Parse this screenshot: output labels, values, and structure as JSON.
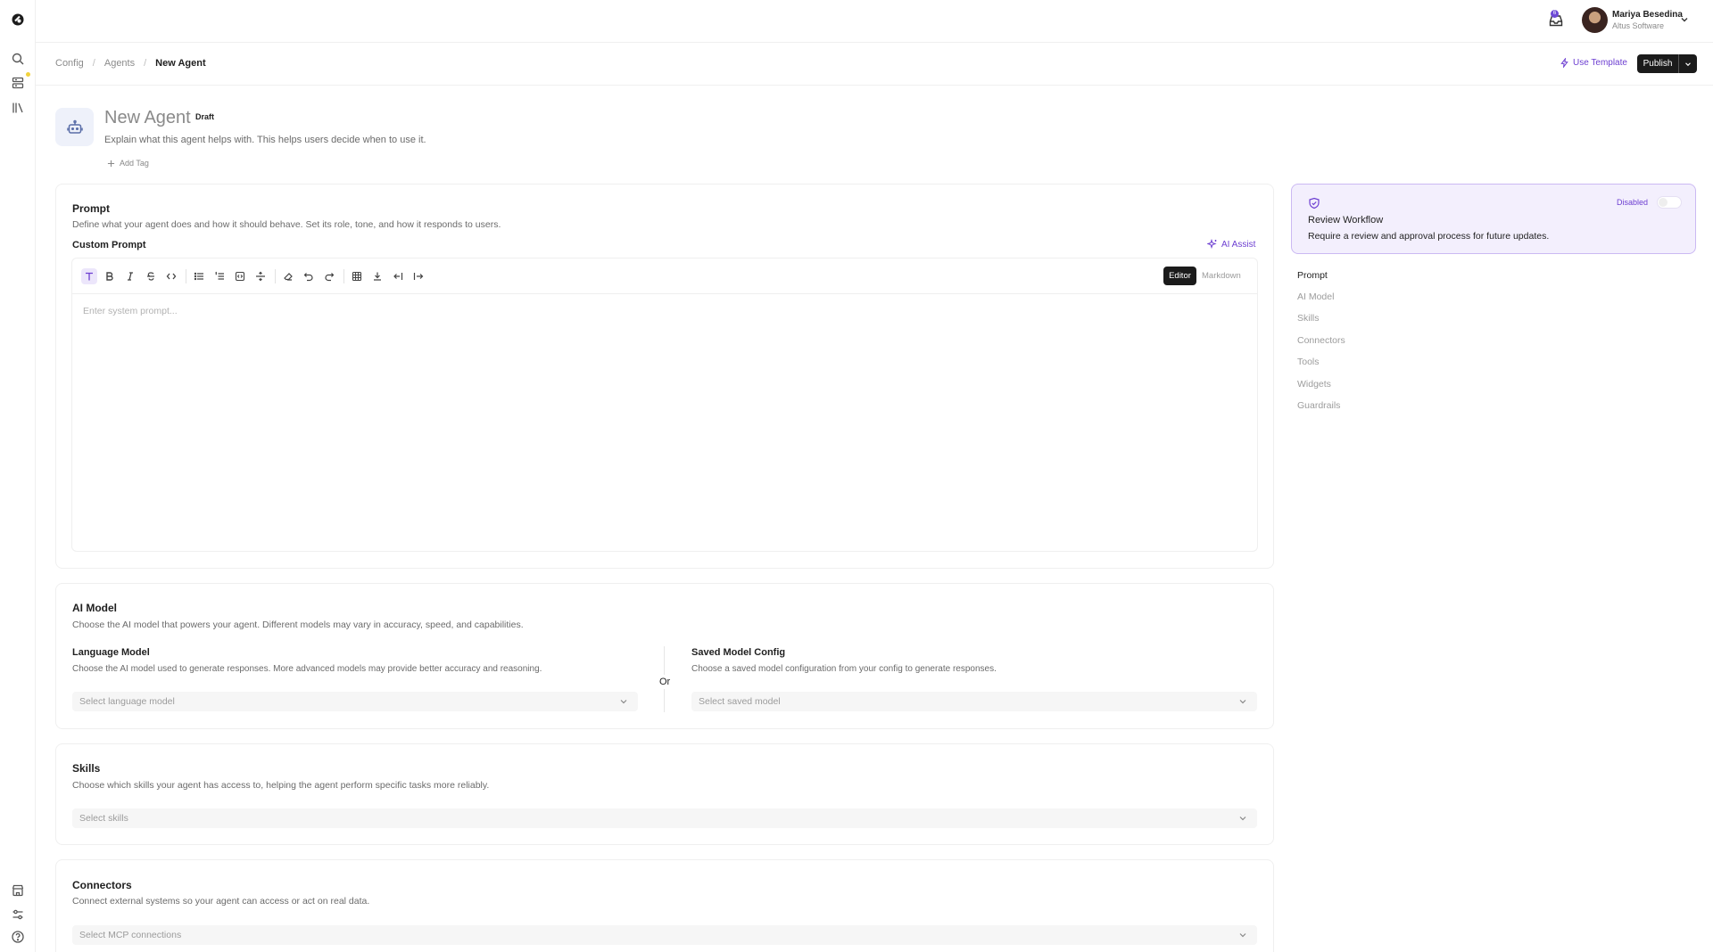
{
  "user": {
    "name": "Mariya Besedina",
    "org": "Altus Software",
    "inbox_count": "6"
  },
  "breadcrumb": {
    "items": [
      "Config",
      "Agents",
      "New Agent"
    ]
  },
  "header_actions": {
    "use_template": "Use Template",
    "publish": "Publish"
  },
  "agent": {
    "title": "New Agent",
    "status": "Draft",
    "description": "Explain what this agent helps with. This helps users decide when to use it.",
    "add_tag": "Add Tag"
  },
  "prompt_section": {
    "title": "Prompt",
    "description": "Define what your agent does and how it should behave. Set its role, tone, and how it responds to users.",
    "custom_prompt_label": "Custom Prompt",
    "ai_assist": "AI Assist",
    "mode_editor": "Editor",
    "mode_markdown": "Markdown",
    "placeholder": "Enter system prompt..."
  },
  "ai_model_section": {
    "title": "AI Model",
    "description": "Choose the AI model that powers your agent. Different models may vary in accuracy, speed, and capabilities.",
    "language_model": {
      "title": "Language Model",
      "description": "Choose the AI model used to generate responses. More advanced models may provide better accuracy and reasoning.",
      "placeholder": "Select language model"
    },
    "or_label": "Or",
    "saved_config": {
      "title": "Saved Model Config",
      "description": "Choose a saved model configuration from your config to generate responses.",
      "placeholder": "Select saved model"
    }
  },
  "skills_section": {
    "title": "Skills",
    "description": "Choose which skills your agent has access to, helping the agent perform specific tasks more reliably.",
    "placeholder": "Select skills"
  },
  "connectors_section": {
    "title": "Connectors",
    "description": "Connect external systems so your agent can access or act on real data.",
    "placeholder": "Select MCP connections"
  },
  "review_workflow": {
    "title": "Review Workflow",
    "description": "Require a review and approval process for future updates.",
    "status": "Disabled",
    "enabled": false
  },
  "toc": {
    "items": [
      "Prompt",
      "AI Model",
      "Skills",
      "Connectors",
      "Tools",
      "Widgets",
      "Guardrails"
    ],
    "active": "Prompt"
  },
  "colors": {
    "accent": "#6d3fd1",
    "dark": "#1b1b1b",
    "review_bg": "#f3effd"
  },
  "icons": {
    "rail": [
      "logo-icon",
      "search-icon",
      "database-icon",
      "library-icon",
      "store-icon",
      "settings-sliders-icon",
      "help-icon"
    ],
    "toolbar": [
      "text-icon",
      "bold-icon",
      "italic-icon",
      "strikethrough-icon",
      "code-icon",
      "bullet-list-icon",
      "ordered-list-icon",
      "code-block-icon",
      "horizontal-rule-icon",
      "eraser-icon",
      "undo-icon",
      "redo-icon",
      "table-icon",
      "download-icon",
      "outdent-icon",
      "indent-icon"
    ]
  }
}
